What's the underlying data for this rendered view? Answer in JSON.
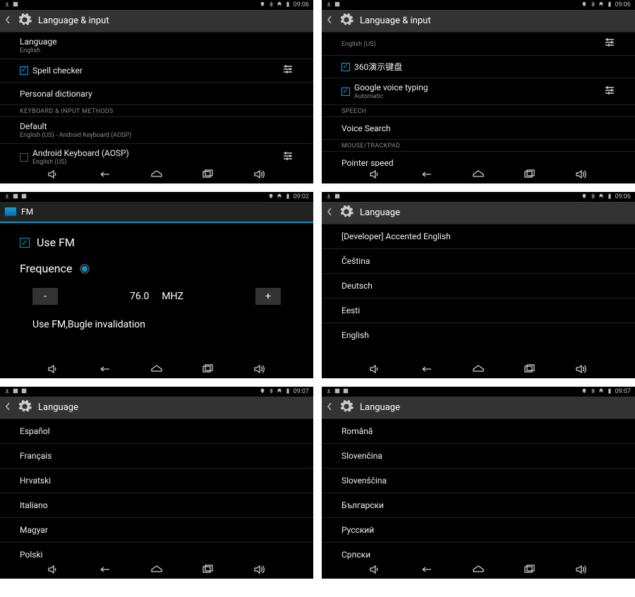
{
  "status_time_0906": "09:06",
  "status_time_0902": "09:02",
  "status_time_0907": "09:07",
  "p1": {
    "title": "Language & input",
    "language_label": "Language",
    "language_sub": "English",
    "spell_label": "Spell checker",
    "pdict_label": "Personal dictionary",
    "section_kbd": "KEYBOARD & INPUT METHODS",
    "default_label": "Default",
    "default_sub": "English (US) - Android Keyboard (AOSP)",
    "aosp_label": "Android Keyboard (AOSP)",
    "aosp_sub": "English (US)"
  },
  "p2": {
    "title": "Language & input",
    "enus_sub": "English (US)",
    "demo_label": "360演示键盘",
    "gvt_label": "Google voice typing",
    "gvt_sub": "Automatic",
    "section_speech": "SPEECH",
    "voice_search": "Voice Search",
    "section_mouse": "MOUSE/TRACKPAD",
    "pointer": "Pointer speed"
  },
  "p3": {
    "title": "FM",
    "use_fm": "Use FM",
    "frequence": "Frequence",
    "minus": "-",
    "val": "76.0",
    "unit": "MHZ",
    "plus": "+",
    "note": "Use FM,Bugle invalidation"
  },
  "p4": {
    "title": "Language",
    "items": [
      "[Developer] Accented English",
      "Čeština",
      "Deutsch",
      "Eesti",
      "English"
    ]
  },
  "p5": {
    "title": "Language",
    "items": [
      "Español",
      "Français",
      "Hrvatski",
      "Italiano",
      "Magyar",
      "Polski"
    ]
  },
  "p6": {
    "title": "Language",
    "items": [
      "Română",
      "Slovenčina",
      "Slovenščina",
      "Български",
      "Русский",
      "Српски"
    ]
  }
}
